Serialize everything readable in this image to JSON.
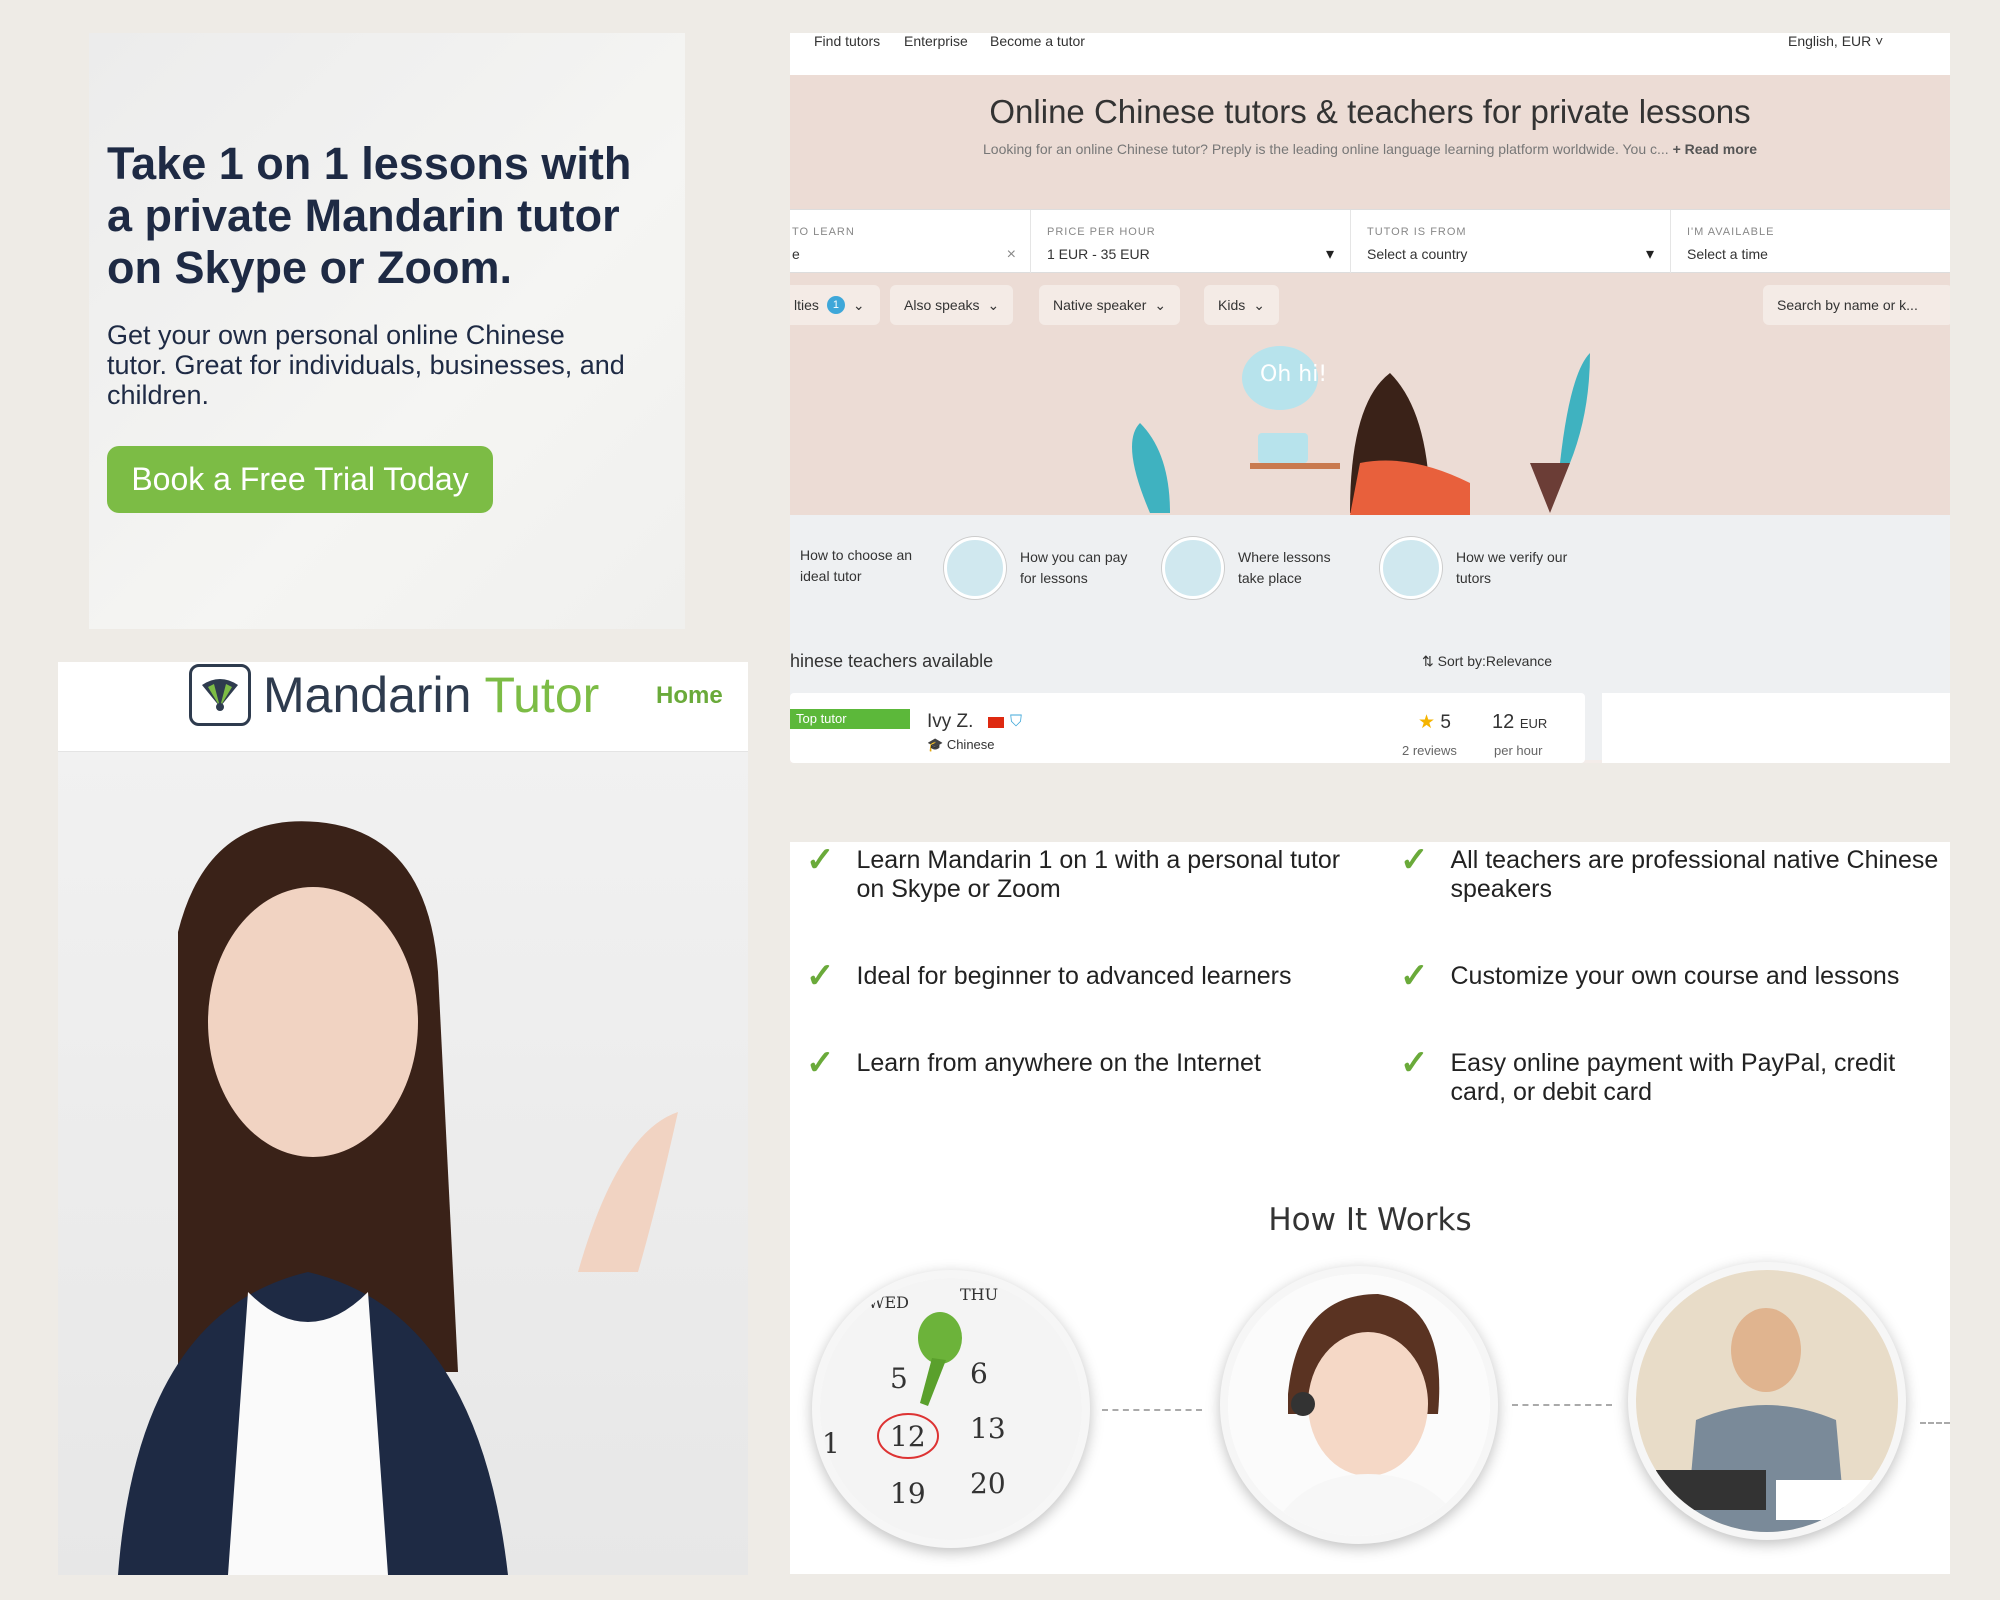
{
  "ad": {
    "headline": "Take 1 on 1 lessons with a private Mandarin tutor on Skype or Zoom.",
    "subtext": "Get your own personal online Chinese tutor.  Great for individuals, businesses, and children.",
    "cta": "Book a Free Trial Today",
    "accent": "#7cbc45"
  },
  "mandarin_tutor": {
    "brand_a": "Mandarin ",
    "brand_b": "Tutor",
    "nav_home": "Home"
  },
  "preply": {
    "nav": [
      "Find tutors",
      "Enterprise",
      "Become a tutor"
    ],
    "lang_currency": "English, EUR",
    "title": "Online Chinese tutors & teachers for private lessons",
    "description": "Looking for an online Chinese tutor? Preply is the leading online language learning platform worldwide. You c...",
    "read_more": "+ Read more",
    "filters": [
      {
        "label": "TO LEARN",
        "value": "e"
      },
      {
        "label": "PRICE PER HOUR",
        "value": "1 EUR - 35 EUR"
      },
      {
        "label": "TUTOR IS FROM",
        "value": "Select a country"
      },
      {
        "label": "I'M AVAILABLE",
        "value": "Select a time"
      }
    ],
    "chips": [
      {
        "label": "lties",
        "badge": "1"
      },
      {
        "label": "Also speaks"
      },
      {
        "label": "Native speaker"
      },
      {
        "label": "Kids"
      }
    ],
    "search_placeholder": "Search by name or k...",
    "bubble_text": "Oh, hi!",
    "info_links": [
      "How to choose an ideal tutor",
      "How you can pay for lessons",
      "Where lessons take place",
      "How we verify our tutors"
    ],
    "available_text": "hinese teachers available",
    "sort_text": "Sort by:Relevance",
    "tutor": {
      "badge": "Top tutor",
      "name": "Ivy Z.",
      "subject": "Chinese",
      "rating": "5",
      "reviews": "2 reviews",
      "price": "12",
      "currency": "EUR",
      "per": "per hour"
    }
  },
  "features": {
    "items": [
      "Learn Mandarin 1 on 1 with a personal tutor on Skype or Zoom",
      "All teachers are professional native Chinese speakers",
      "Ideal for beginner to advanced learners",
      "Customize your own course and lessons",
      "Learn from anywhere on the Internet",
      "Easy online payment with PayPal, credit card, or debit card"
    ],
    "how_title": "How It Works",
    "calendar_numbers": [
      "WED",
      "THU",
      "5",
      "6",
      "1",
      "12",
      "13",
      "19",
      "20"
    ]
  }
}
